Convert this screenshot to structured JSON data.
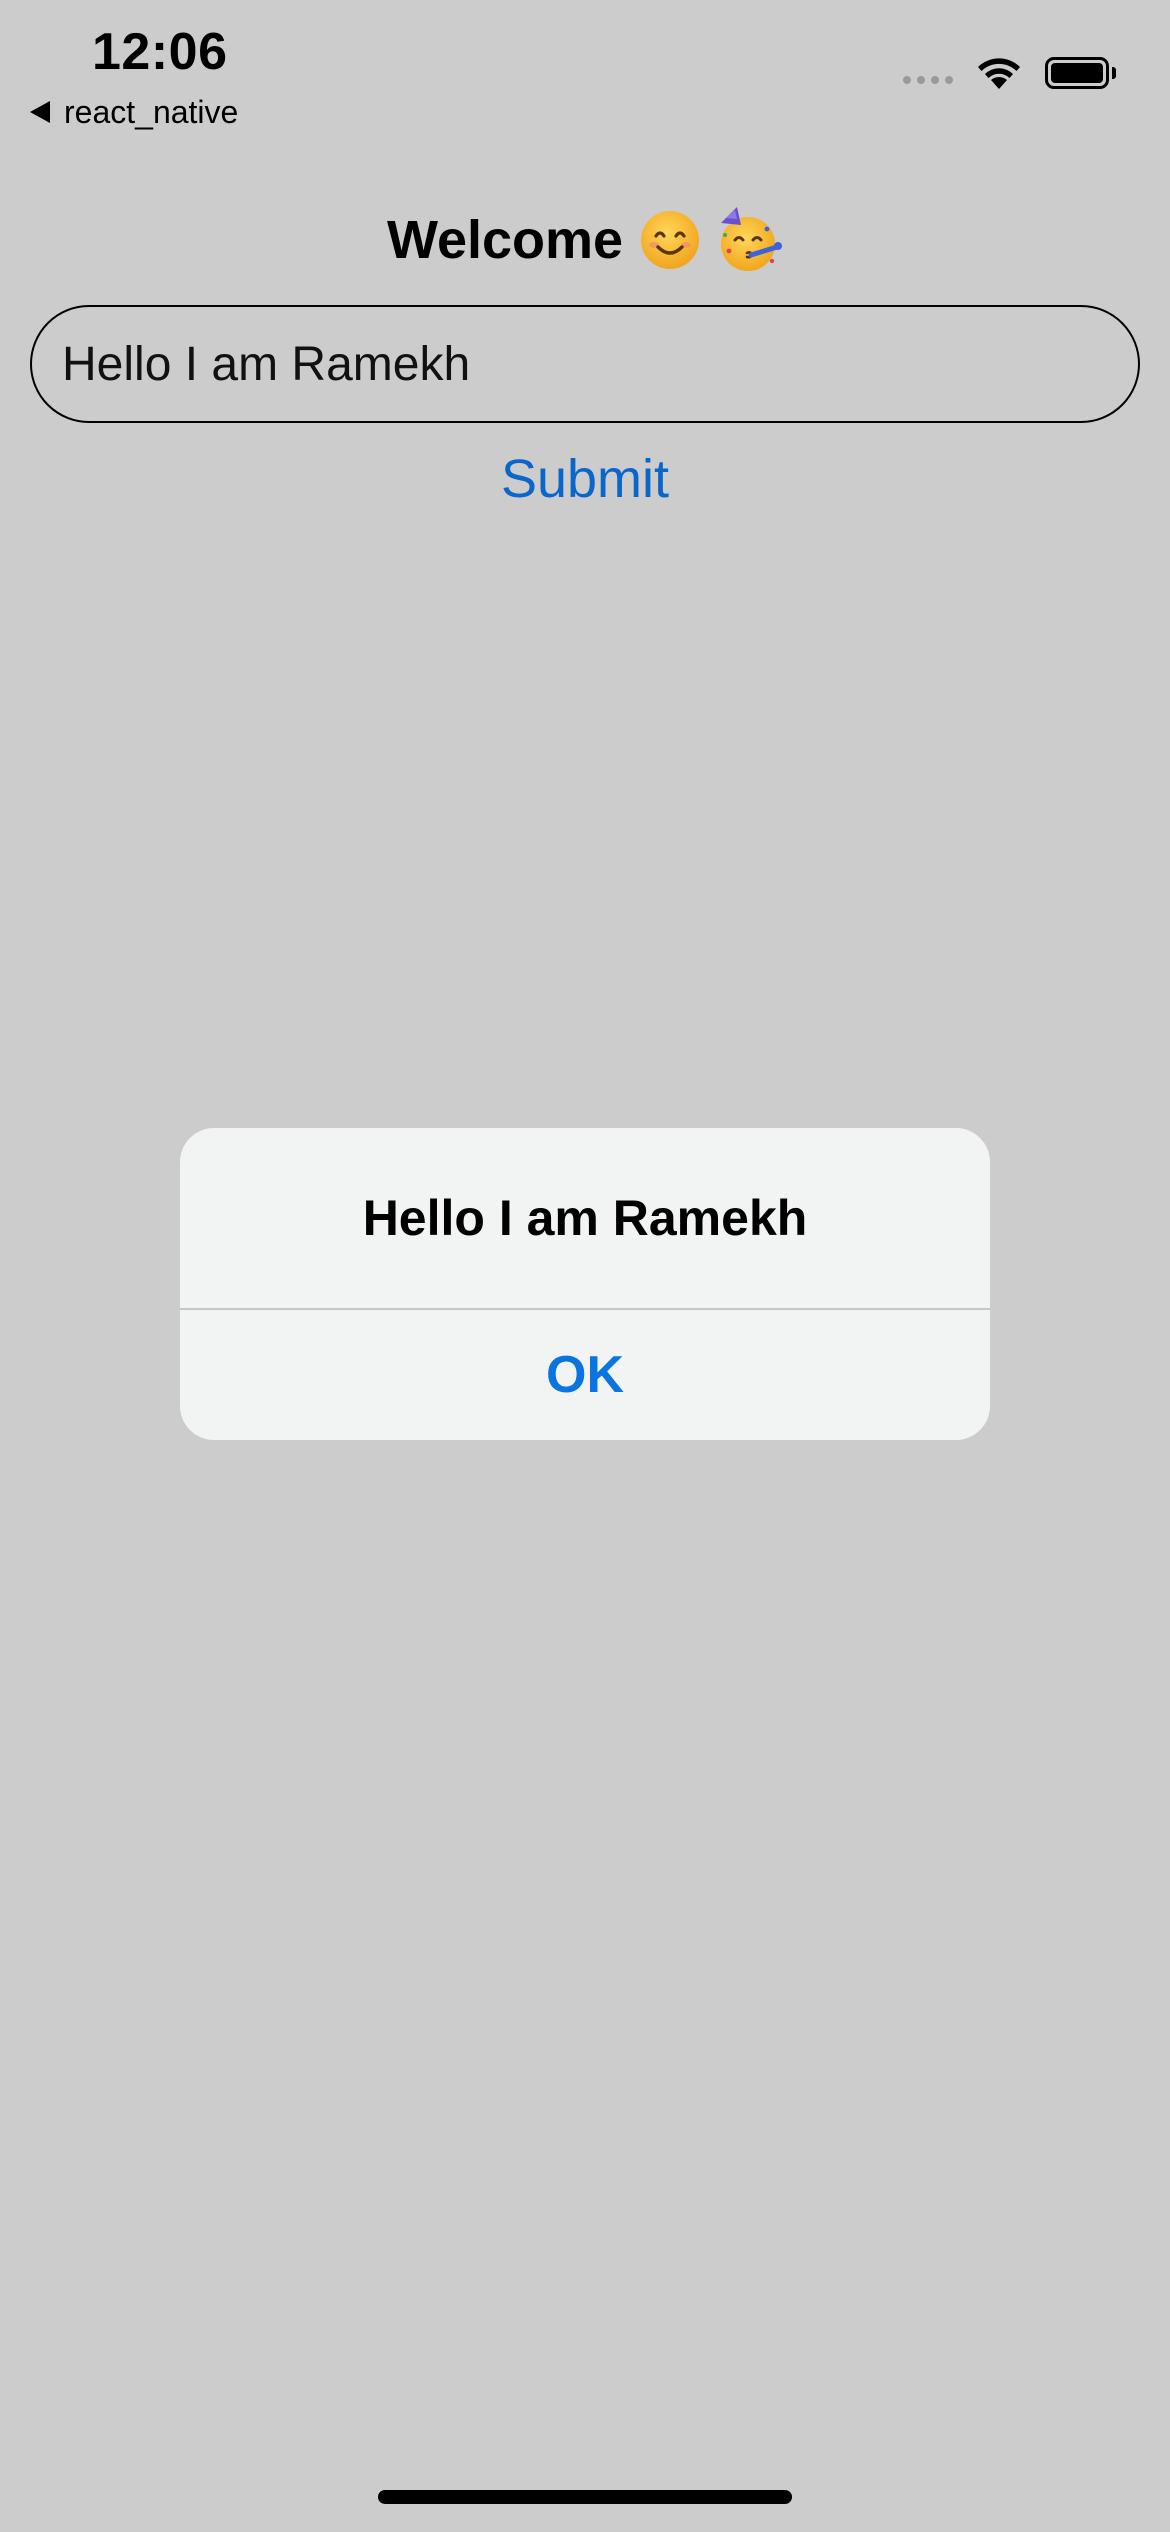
{
  "status_bar": {
    "time": "12:06",
    "back_app_label": "react_native",
    "icons": [
      "back-arrow-icon",
      "cellular-signal-icon",
      "wifi-icon",
      "battery-icon"
    ]
  },
  "main": {
    "title": "Welcome",
    "title_emojis": [
      "smiling-face-with-smiling-eyes",
      "partying-face"
    ],
    "input": {
      "value": "Hello I am Ramekh"
    },
    "submit_label": "Submit"
  },
  "alert": {
    "title": "Hello I am Ramekh",
    "ok_label": "OK"
  },
  "colors": {
    "background": "#cccccc",
    "link_blue": "#0a66c8",
    "alert_button_blue": "#0a74e0",
    "alert_background": "#f2f3f3"
  }
}
